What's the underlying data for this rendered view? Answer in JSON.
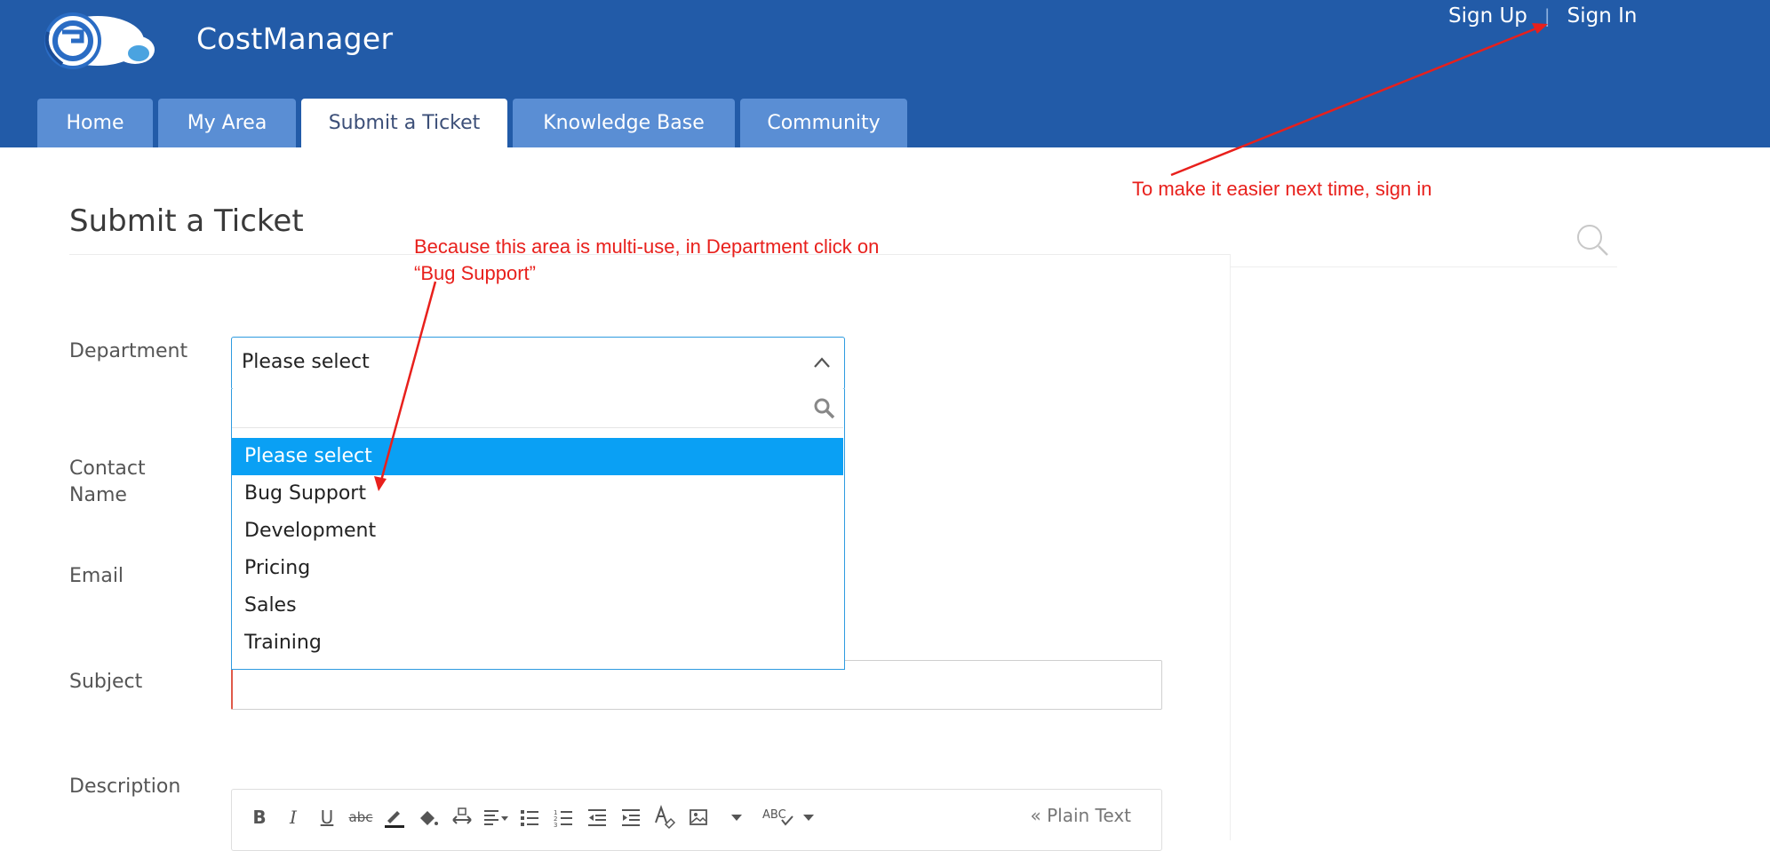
{
  "app": {
    "name": "CostManager"
  },
  "header": {
    "sign_up": "Sign Up",
    "sign_in": "Sign In"
  },
  "tabs": [
    {
      "label": "Home",
      "active": false
    },
    {
      "label": "My Area",
      "active": false
    },
    {
      "label": "Submit a Ticket",
      "active": true
    },
    {
      "label": "Knowledge Base",
      "active": false
    },
    {
      "label": "Community",
      "active": false
    }
  ],
  "page": {
    "title": "Submit a Ticket"
  },
  "form": {
    "department": {
      "label": "Department",
      "value": "Please select",
      "search_value": "",
      "options": [
        "Please select",
        "Bug Support",
        "Development",
        "Pricing",
        "Sales",
        "Training"
      ],
      "selected": "Please select"
    },
    "contact_label_line1": "Contact",
    "contact_label_line2": "Name",
    "email_label": "Email",
    "subject_label": "Subject",
    "description_label": "Description",
    "editor": {
      "toolbar_icons": [
        "bold-icon",
        "italic-icon",
        "underline-icon",
        "strikethrough-icon",
        "text-color-icon",
        "fill-color-icon",
        "text-direction-icon",
        "align-icon",
        "bullet-list-icon",
        "numbered-list-icon",
        "outdent-icon",
        "indent-icon",
        "clear-format-icon",
        "image-icon",
        "more-icon",
        "spellcheck-icon"
      ],
      "plain_text": "« Plain Text"
    }
  },
  "annotations": {
    "sign_in_note": "To make it easier next time,  sign in",
    "department_note_line1": "Because this area is multi-use,  in Department click on",
    "department_note_line2": "“Bug Support”"
  },
  "colors": {
    "header": "#225ba8",
    "tab": "#5a8ed4",
    "annotation": "#e8201c",
    "highlight": "#0aa0f4"
  }
}
